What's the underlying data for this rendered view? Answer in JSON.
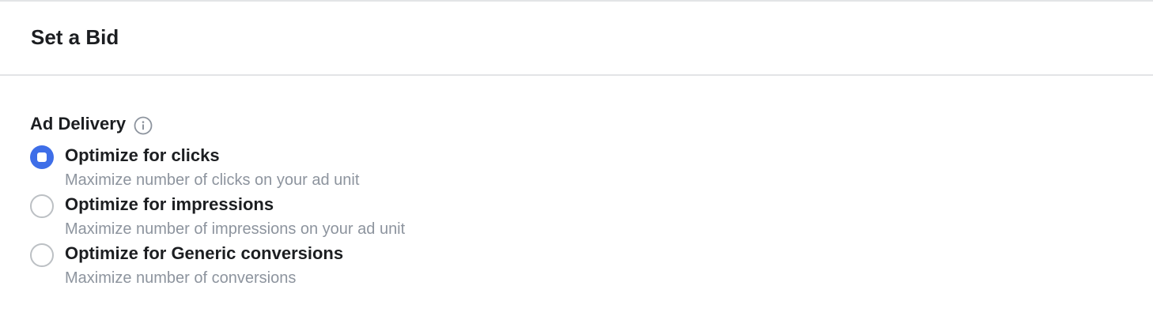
{
  "header": {
    "title": "Set a Bid"
  },
  "ad_delivery": {
    "label": "Ad Delivery",
    "info_icon": "info-circle-icon",
    "options": [
      {
        "title": "Optimize for clicks",
        "description": "Maximize number of clicks on your ad unit",
        "selected": true
      },
      {
        "title": "Optimize for impressions",
        "description": "Maximize number of impressions on your ad unit",
        "selected": false
      },
      {
        "title": "Optimize for Generic conversions",
        "description": "Maximize number of conversions",
        "selected": false
      }
    ]
  },
  "colors": {
    "accent": "#3e6ee8",
    "text_primary": "#1c1e21",
    "text_secondary": "#8d949e",
    "divider": "#e3e4e6",
    "radio_border": "#bcc0c4"
  }
}
